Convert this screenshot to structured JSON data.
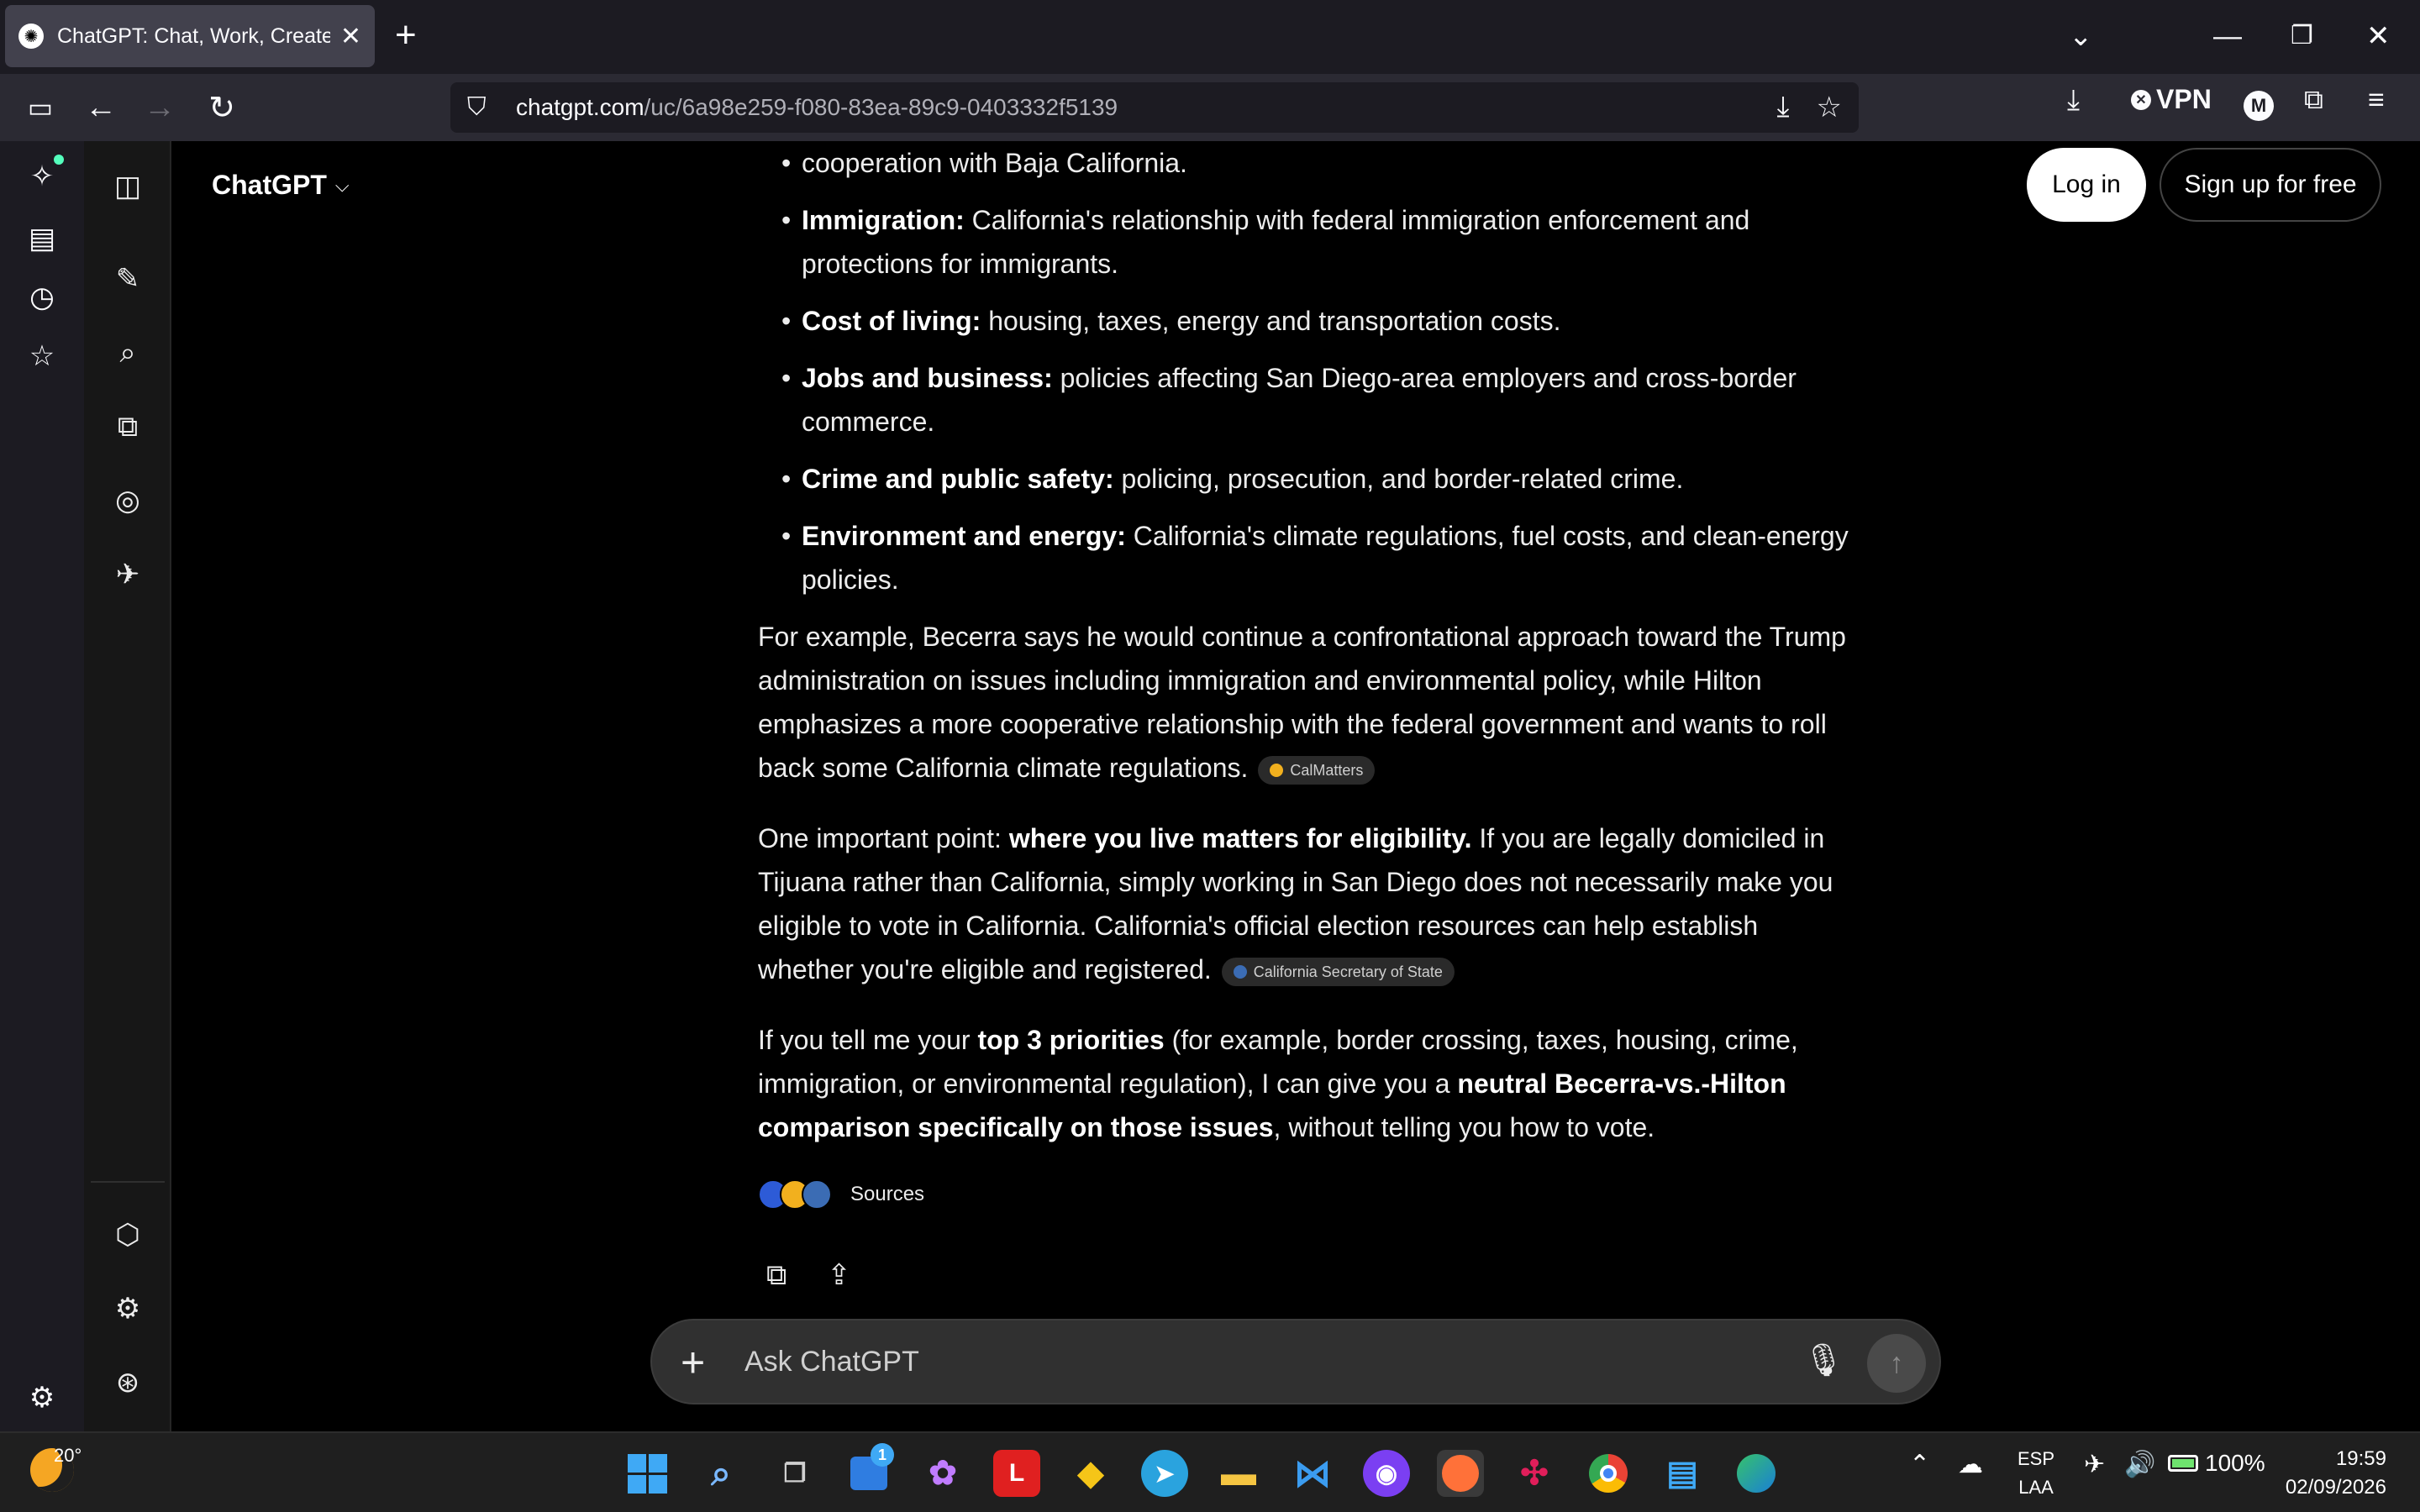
{
  "browser": {
    "tab_title": "ChatGPT: Chat, Work, Create &",
    "url_domain": "chatgpt.com",
    "url_path": "/uc/6a98e259-f080-83ea-89c9-0403332f5139",
    "vpn_label": "VPN",
    "profile_initial": "M"
  },
  "app": {
    "brand": "ChatGPT",
    "login_label": "Log in",
    "signup_label": "Sign up for free"
  },
  "content": {
    "partial_top_line": "cooperation with Baja California.",
    "bullets": [
      {
        "term": "Immigration:",
        "text": " California's relationship with federal immigration enforcement and protections for immigrants."
      },
      {
        "term": "Cost of living:",
        "text": " housing, taxes, energy and transportation costs."
      },
      {
        "term": "Jobs and business:",
        "text": " policies affecting San Diego-area employers and cross-border commerce."
      },
      {
        "term": "Crime and public safety:",
        "text": " policing, prosecution, and border-related crime."
      },
      {
        "term": "Environment and energy:",
        "text": " California's climate regulations, fuel costs, and clean-energy policies."
      }
    ],
    "p1": "For example, Becerra says he would continue a confrontational approach toward the Trump administration on issues including immigration and environmental policy, while Hilton emphasizes a more cooperative relationship with the federal government and wants to roll back some California climate regulations.",
    "p1_cite": "CalMatters",
    "p2_a": "One important point: ",
    "p2_b": "where you live matters for eligibility.",
    "p2_c": " If you are legally domiciled in Tijuana rather than California, simply working in San Diego does not necessarily make you eligible to vote in California. California's official election resources can help establish whether you're eligible and registered.",
    "p2_cite": "California Secretary of State",
    "p3_a": "If you tell me your ",
    "p3_b": "top 3 priorities",
    "p3_c": " (for example, border crossing, taxes, housing, crime, immigration, or environmental regulation), I can give you a ",
    "p3_d": "neutral Becerra-vs.-Hilton comparison specifically on those issues",
    "p3_e": ", without telling you how to vote.",
    "sources_label": "Sources"
  },
  "composer": {
    "placeholder": "Ask ChatGPT"
  },
  "taskbar": {
    "temperature": "20°",
    "store_badge": "1",
    "lang_top": "ESP",
    "lang_bottom": "LAA",
    "battery": "100%",
    "time": "19:59",
    "date": "02/09/2026"
  },
  "colors": {
    "page_bg": "#000000",
    "rail_bg": "#171717",
    "composer_bg": "#303030",
    "chrome_bg": "#2b2a33"
  }
}
